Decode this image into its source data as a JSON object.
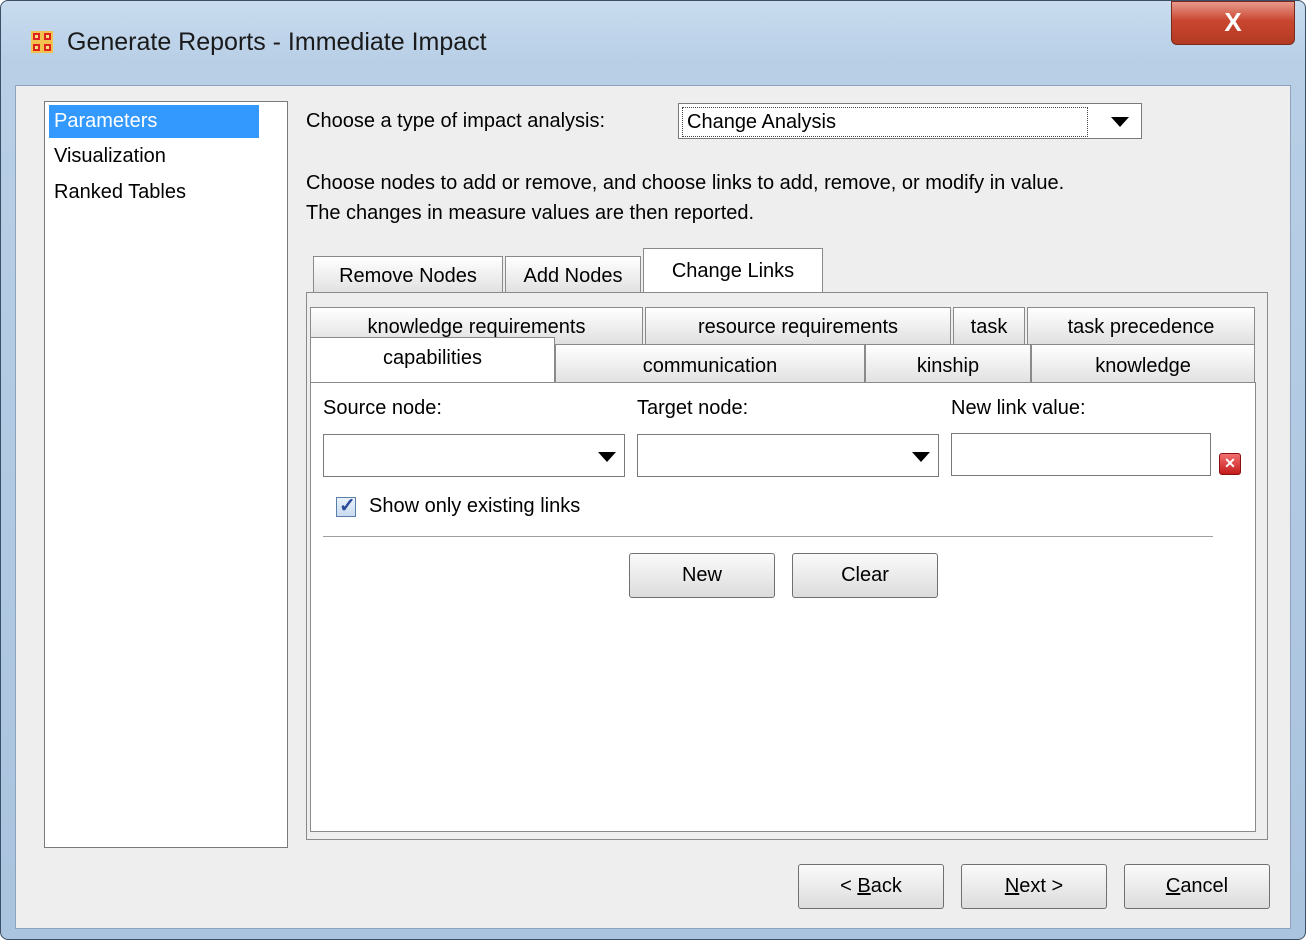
{
  "window": {
    "title": "Generate Reports - Immediate Impact",
    "close_label": "X"
  },
  "nav": {
    "items": [
      {
        "label": "Parameters",
        "selected": true
      },
      {
        "label": "Visualization",
        "selected": false
      },
      {
        "label": "Ranked Tables",
        "selected": false
      }
    ]
  },
  "analysis": {
    "label": "Choose a type of impact analysis:",
    "selected": "Change Analysis"
  },
  "description": {
    "line1": "Choose nodes to add or remove, and choose links to add, remove, or modify in value.",
    "line2": "The changes in measure values are then reported."
  },
  "main_tabs": [
    "Remove Nodes",
    "Add Nodes",
    "Change Links"
  ],
  "main_tab_active": "Change Links",
  "link_tabs_row1": [
    "knowledge requirements",
    "resource requirements",
    "task",
    "task precedence"
  ],
  "link_tabs_row2": [
    "capabilities",
    "communication",
    "kinship",
    "knowledge"
  ],
  "link_tab_active": "capabilities",
  "form": {
    "source_label": "Source node:",
    "target_label": "Target node:",
    "value_label": "New link value:",
    "source_value": "",
    "target_value": "",
    "value_input": "",
    "checkbox_label": "Show only existing links",
    "checkbox_checked": true,
    "new_button": "New",
    "clear_button": "Clear"
  },
  "footer": {
    "back_prefix": "< ",
    "back_mnemonic": "B",
    "back_rest": "ack",
    "next_mnemonic": "N",
    "next_rest": "ext >",
    "cancel_mnemonic": "C",
    "cancel_rest": "ancel"
  },
  "colors": {
    "selection": "#3399ff",
    "close_button": "#c9462f",
    "clear_icon": "#d83030"
  }
}
